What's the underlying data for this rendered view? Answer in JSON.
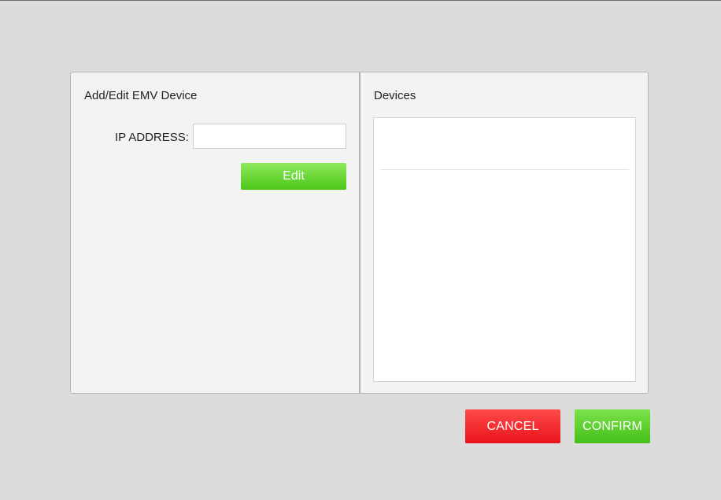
{
  "dialog": {
    "left_panel": {
      "title": "Add/Edit EMV Device",
      "ip_label": "IP ADDRESS:",
      "ip_value": "",
      "ip_placeholder": "",
      "edit_label": "Edit"
    },
    "right_panel": {
      "title": "Devices",
      "items": [
        ""
      ]
    }
  },
  "footer": {
    "cancel_label": "CANCEL",
    "confirm_label": "CONFIRM"
  },
  "colors": {
    "background": "#dcdcdc",
    "panel": "#f3f3f3",
    "green": "#4cc71a",
    "red": "#e8141a"
  }
}
